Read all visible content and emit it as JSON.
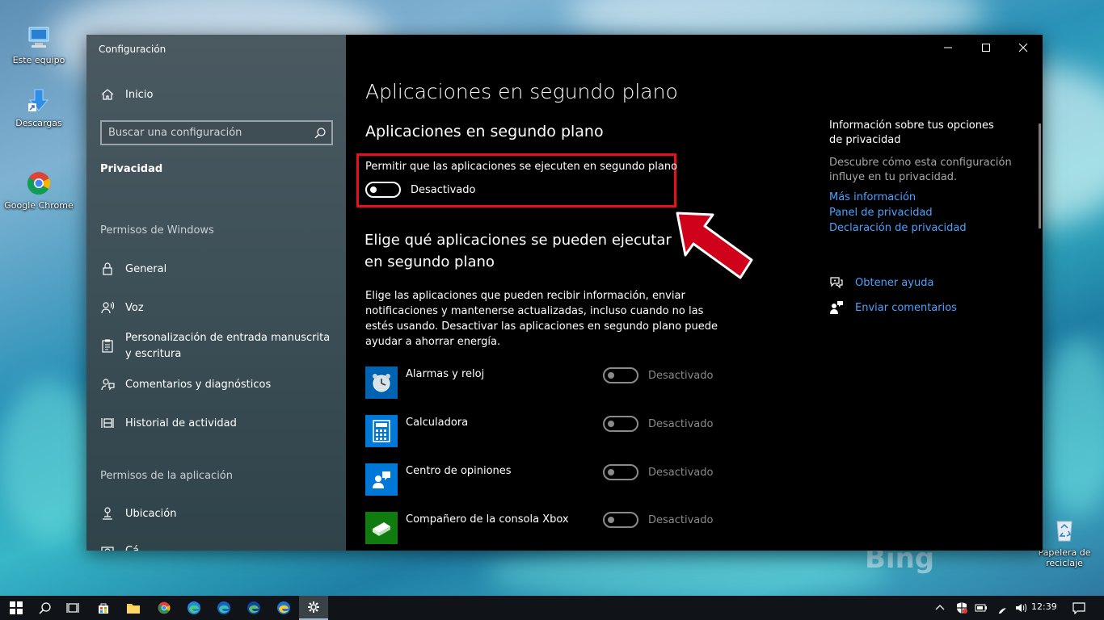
{
  "desktop": {
    "icons": [
      {
        "label": "Este equipo"
      },
      {
        "label": "Descargas"
      },
      {
        "label": "Google Chrome"
      },
      {
        "label": "Papelera de reciclaje"
      }
    ],
    "watermark": "Bing"
  },
  "window": {
    "title": "Configuración",
    "controls": {
      "minimize": "—",
      "maximize": "☐",
      "close": "✕"
    }
  },
  "sidebar": {
    "home": "Inicio",
    "search_placeholder": "Buscar una configuración",
    "selected": "Privacidad",
    "windows_permissions_heading": "Permisos de Windows",
    "windows_items": [
      {
        "label": "General",
        "icon": "lock-icon"
      },
      {
        "label": "Voz",
        "icon": "speech-icon"
      },
      {
        "label": "Personalización de entrada manuscrita y escritura",
        "icon": "clipboard-icon"
      },
      {
        "label": "Comentarios y diagnósticos",
        "icon": "feedback-icon"
      },
      {
        "label": "Historial de actividad",
        "icon": "timeline-icon"
      }
    ],
    "app_permissions_heading": "Permisos de la aplicación",
    "app_items": [
      {
        "label": "Ubicación",
        "icon": "location-icon"
      },
      {
        "label": "Cá",
        "icon": "camera-icon"
      }
    ]
  },
  "main": {
    "page_title": "Aplicaciones en segundo plano",
    "section1_title": "Aplicaciones en segundo plano",
    "allow_label": "Permitir que las aplicaciones se ejecuten en segundo plano",
    "allow_state": "Desactivado",
    "section2_title": "Elige qué aplicaciones se pueden ejecutar en segundo plano",
    "section2_desc": "Elige las aplicaciones que pueden recibir información, enviar notificaciones y mantenerse actualizadas, incluso cuando no las estés usando. Desactivar las aplicaciones en segundo plano puede ayudar a ahorrar energía.",
    "apps": [
      {
        "name": "Alarmas y reloj",
        "state": "Desactivado",
        "color": "#0063b1",
        "icon": "clock-icon"
      },
      {
        "name": "Calculadora",
        "state": "Desactivado",
        "color": "#0078d7",
        "icon": "calculator-icon"
      },
      {
        "name": "Centro de opiniones",
        "state": "Desactivado",
        "color": "#0078d7",
        "icon": "feedback-hub-icon"
      },
      {
        "name": "Compañero de la consola Xbox",
        "state": "Desactivado",
        "color": "#107c10",
        "icon": "xbox-icon"
      }
    ]
  },
  "right_panel": {
    "info_title": "Información sobre tus opciones de privacidad",
    "info_desc": "Descubre cómo esta configuración influye en tu privacidad.",
    "links": [
      "Más información",
      "Panel de privacidad",
      "Declaración de privacidad"
    ],
    "help": "Obtener ayuda",
    "feedback": "Enviar comentarios"
  },
  "taskbar": {
    "time": "12:39"
  },
  "colors": {
    "accent_link": "#4aa3ff",
    "highlight_box": "#e8101a",
    "arrow": "#d0021b"
  }
}
